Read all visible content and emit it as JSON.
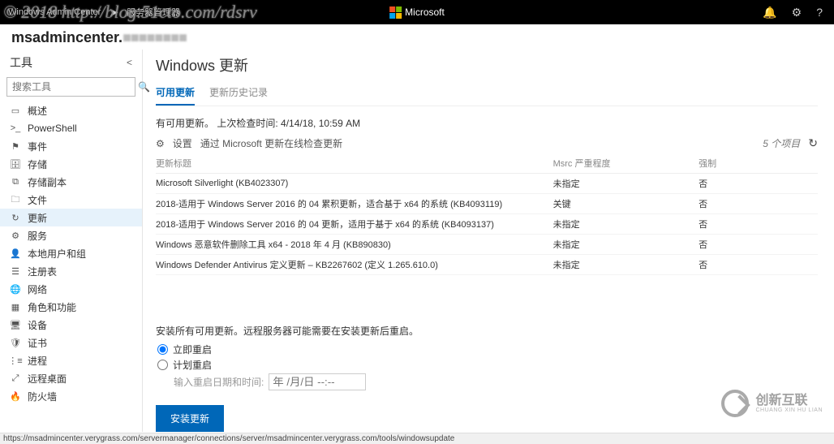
{
  "watermark": "© 2018 http://blog.51cto.com/rdsrv",
  "topbar": {
    "product": "Windows Admin Center",
    "breadcrumb": "服务器管理器",
    "brand": "Microsoft"
  },
  "server_name_prefix": "msadmincenter.",
  "sidebar": {
    "tools_label": "工具",
    "search_placeholder": "搜索工具",
    "items": [
      {
        "icon": "overview-icon",
        "label": "概述"
      },
      {
        "icon": "powershell-icon",
        "label": "PowerShell"
      },
      {
        "icon": "events-icon",
        "label": "事件"
      },
      {
        "icon": "storage-icon",
        "label": "存储"
      },
      {
        "icon": "replica-icon",
        "label": "存储副本"
      },
      {
        "icon": "files-icon",
        "label": "文件"
      },
      {
        "icon": "updates-icon",
        "label": "更新",
        "active": true
      },
      {
        "icon": "services-icon",
        "label": "服务"
      },
      {
        "icon": "users-icon",
        "label": "本地用户和组"
      },
      {
        "icon": "registry-icon",
        "label": "注册表"
      },
      {
        "icon": "network-icon",
        "label": "网络"
      },
      {
        "icon": "roles-icon",
        "label": "角色和功能"
      },
      {
        "icon": "devices-icon",
        "label": "设备"
      },
      {
        "icon": "certs-icon",
        "label": "证书"
      },
      {
        "icon": "processes-icon",
        "label": "进程"
      },
      {
        "icon": "remotedesktop-icon",
        "label": "远程桌面"
      },
      {
        "icon": "firewall-icon",
        "label": "防火墙"
      }
    ]
  },
  "content": {
    "title": "Windows 更新",
    "tabs": [
      {
        "label": "可用更新",
        "active": true
      },
      {
        "label": "更新历史记录",
        "active": false
      }
    ],
    "status_prefix": "有可用更新。 上次检查时间: ",
    "status_time": "4/14/18, 10:59 AM",
    "settings_label": "设置",
    "settings_sublabel": "通过 Microsoft 更新在线检查更新",
    "item_count": "5 个项目",
    "columns": {
      "title": "更新标题",
      "severity": "Msrc 严重程度",
      "mandatory": "强制"
    },
    "rows": [
      {
        "title": "Microsoft Silverlight (KB4023307)",
        "severity": "未指定",
        "mandatory": "否"
      },
      {
        "title": "2018-适用于 Windows Server 2016 的 04 累积更新，适合基于 x64 的系统 (KB4093119)",
        "severity": "关键",
        "mandatory": "否"
      },
      {
        "title": "2018-适用于 Windows Server 2016 的 04 更新，适用于基于 x64 的系统 (KB4093137)",
        "severity": "未指定",
        "mandatory": "否"
      },
      {
        "title": "Windows 恶意软件删除工具 x64 - 2018 年 4 月 (KB890830)",
        "severity": "未指定",
        "mandatory": "否"
      },
      {
        "title": "Windows Defender Antivirus 定义更新 – KB2267602 (定义 1.265.610.0)",
        "severity": "未指定",
        "mandatory": "否"
      }
    ],
    "install_note": "安装所有可用更新。远程服务器可能需要在安装更新后重启。",
    "radio_now": "立即重启",
    "radio_schedule": "计划重启",
    "schedule_label": "输入重启日期和时间:",
    "schedule_placeholder": "年 /月/日 --:--",
    "install_button": "安装更新"
  },
  "statusbar": "https://msadmincenter.verygrass.com/servermanager/connections/server/msadmincenter.verygrass.com/tools/windowsupdate",
  "cx_logo": {
    "cn": "创新互联",
    "en": "CHUANG XIN HU LIAN"
  }
}
